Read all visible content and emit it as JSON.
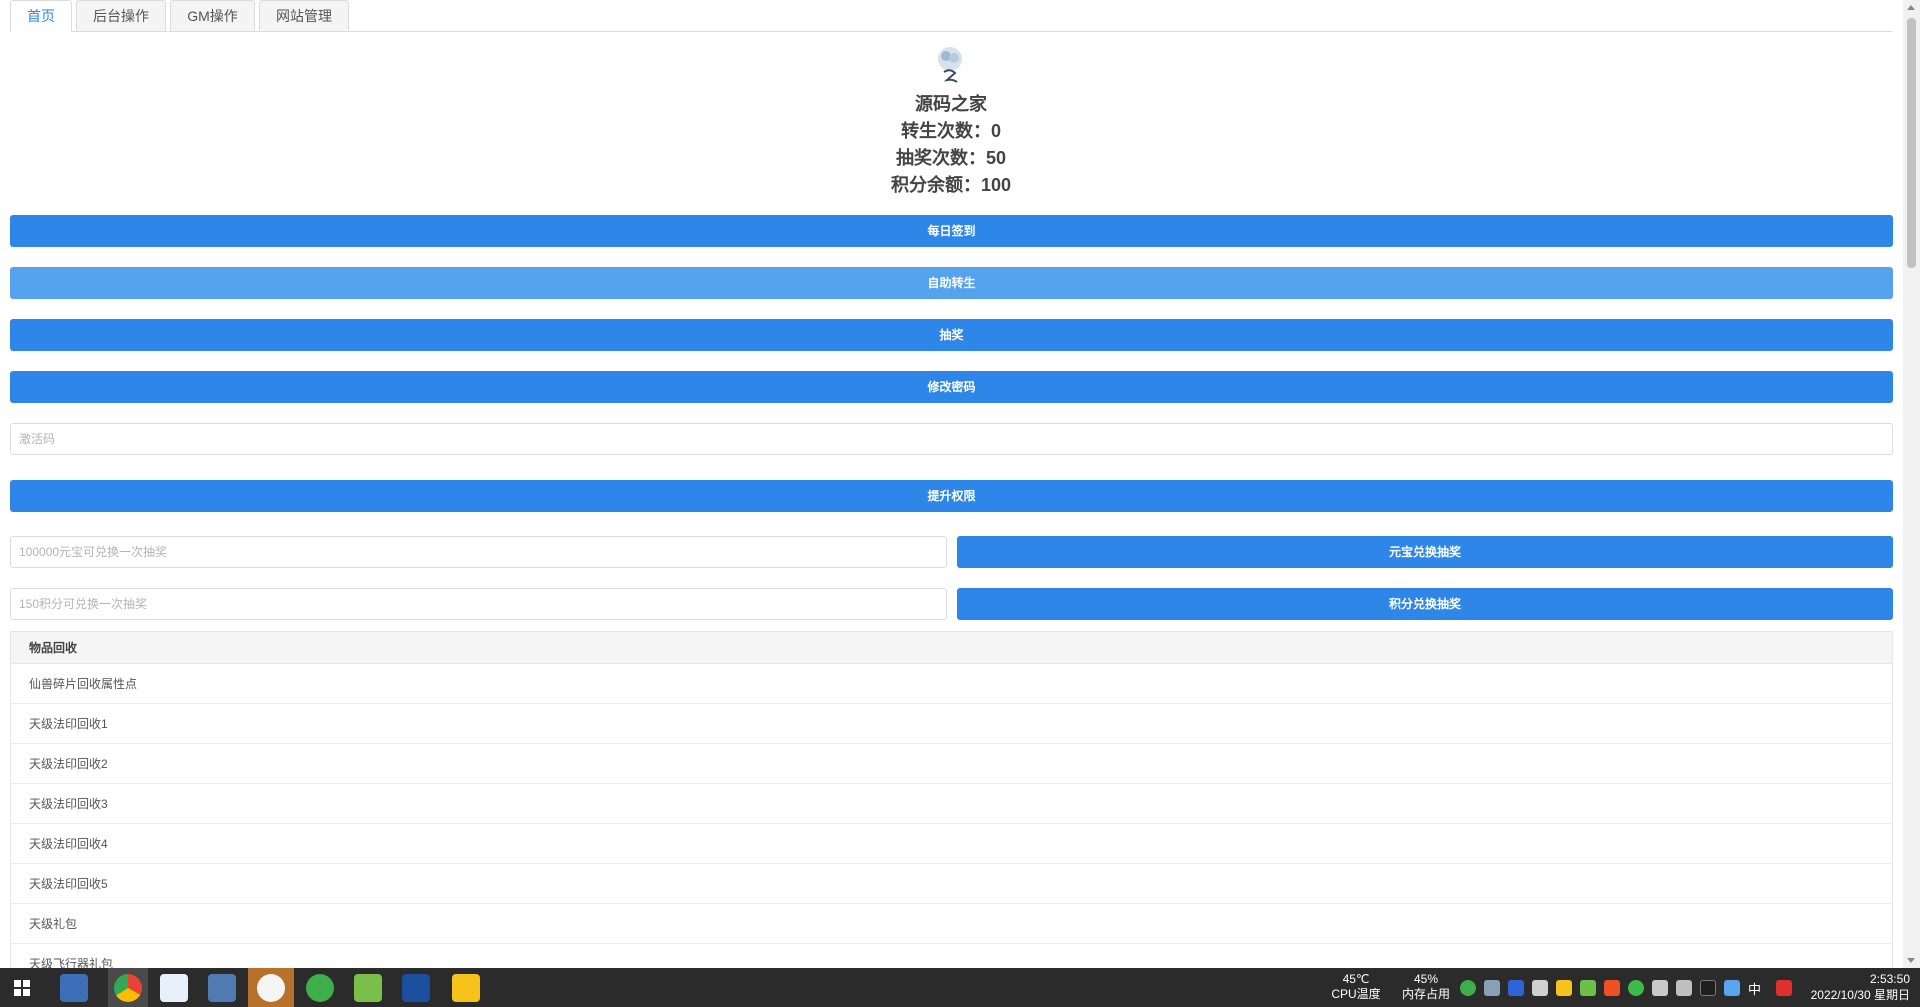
{
  "tabs": [
    "首页",
    "后台操作",
    "GM操作",
    "网站管理"
  ],
  "profile": {
    "name": "源码之家",
    "rebirth": "转生次数：0",
    "lottery": "抽奖次数：50",
    "points": "积分余额：100"
  },
  "buttons": {
    "checkin": "每日签到",
    "rebirth": "自助转生",
    "lottery": "抽奖",
    "password": "修改密码",
    "upgrade": "提升权限",
    "yuanbao_exchange": "元宝兑换抽奖",
    "points_exchange": "积分兑换抽奖"
  },
  "inputs": {
    "activation_placeholder": "激活码",
    "yuanbao_placeholder": "100000元宝可兑换一次抽奖",
    "points_placeholder": "150积分可兑换一次抽奖"
  },
  "recycle": {
    "title": "物品回收",
    "items": [
      "仙兽碎片回收属性点",
      "天级法印回收1",
      "天级法印回收2",
      "天级法印回收3",
      "天级法印回收4",
      "天级法印回收5",
      "天级礼包",
      "天级飞行器礼包"
    ]
  },
  "taskbar": {
    "cpu_value": "45℃",
    "cpu_label": "CPU温度",
    "mem_value": "45%",
    "mem_label": "内存占用",
    "ime": "中",
    "time": "2:53:50",
    "date": "2022/10/30 星期日"
  },
  "colors": {
    "primary": "#2e86e8",
    "primary_light": "#55a2ef"
  }
}
